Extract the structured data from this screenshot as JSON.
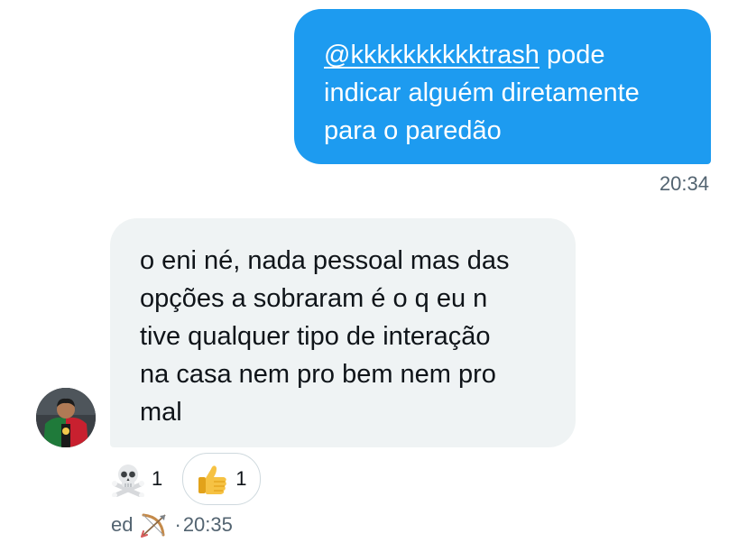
{
  "outgoing": {
    "mention": "@kkkkkkkkkktrash",
    "text_line1": " pode",
    "text_line2": "indicar alguém diretamente",
    "text_line3": "para o paredão",
    "time": "20:34"
  },
  "incoming": {
    "lines": [
      "o eni né, nada pessoal mas das",
      "opções a sobraram é o q eu n",
      "tive qualquer tipo de interação",
      "na casa nem pro bem nem pro",
      "mal"
    ],
    "reactions": [
      {
        "emoji": "skull-crossbones-icon",
        "count": "1"
      },
      {
        "emoji": "thumbs-up-icon",
        "count": "1"
      }
    ],
    "sender": "ed",
    "sender_emoji": "bow-and-arrow-icon",
    "separator": "·",
    "time": "20:35"
  },
  "colors": {
    "accent": "#1d9bf0",
    "incoming_bubble": "#eff3f4",
    "muted_text": "#536471"
  }
}
